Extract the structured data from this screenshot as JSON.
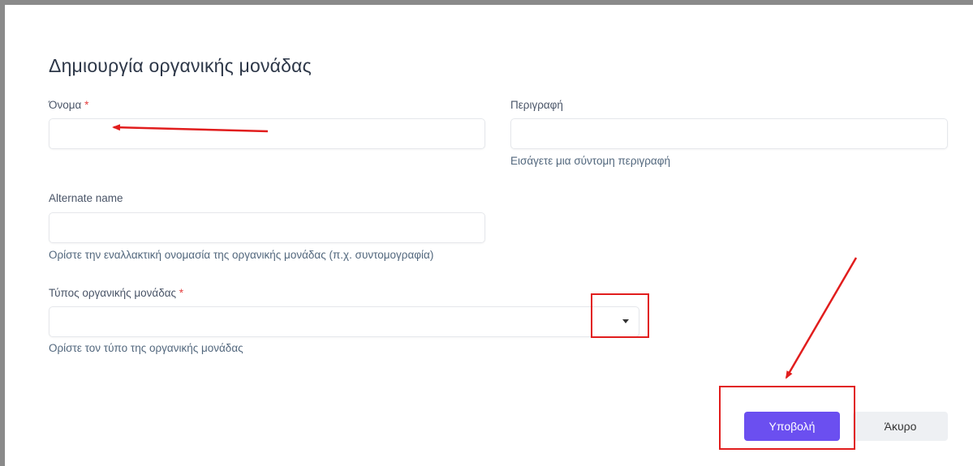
{
  "form": {
    "title": "Δημιουργία οργανικής μονάδας",
    "name": {
      "label": "Όνομα",
      "required_mark": "*",
      "value": "",
      "placeholder": ""
    },
    "description": {
      "label": "Περιγραφή",
      "value": "",
      "placeholder": "",
      "help": "Εισάγετε μια σύντομη περιγραφή"
    },
    "alternate_name": {
      "label": "Alternate name",
      "value": "",
      "placeholder": "",
      "help": "Ορίστε την εναλλακτική ονομασία της οργανικής μονάδας (π.χ. συντομογραφία)"
    },
    "unit_type": {
      "label": "Τύπος οργανικής μονάδας",
      "required_mark": "*",
      "selected": "",
      "help": "Ορίστε τον τύπο της οργανικής μονάδας"
    }
  },
  "actions": {
    "submit_label": "Υποβολή",
    "cancel_label": "Άκυρο"
  },
  "colors": {
    "primary": "#6b4ff0",
    "annotation": "#e11d1d",
    "required": "#e53e3e"
  }
}
